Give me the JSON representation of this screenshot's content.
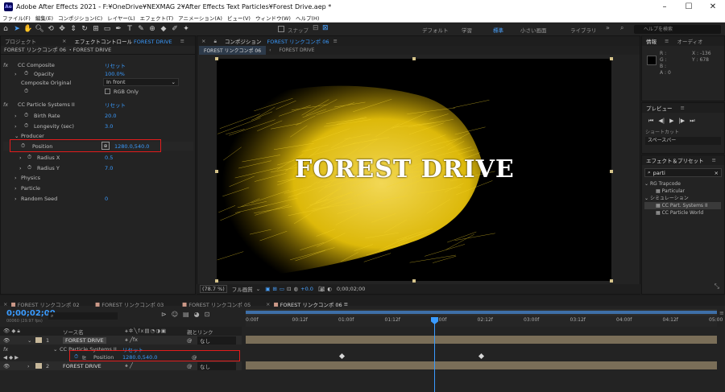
{
  "window": {
    "title": "Adobe After Effects 2021 - F:¥OneDrive¥NEXMAG 2¥After Effects Text Particles¥Forest Drive.aep *",
    "app_logo": "Ae"
  },
  "menu": [
    "ファイル(F)",
    "編集(E)",
    "コンポジション(C)",
    "レイヤー(L)",
    "エフェクト(T)",
    "アニメーション(A)",
    "ビュー(V)",
    "ウィンドウ(W)",
    "ヘルプ(H)"
  ],
  "toolbar": {
    "snap_label": "スナップ",
    "workspaces": [
      "デフォルト",
      "学習",
      "標準",
      "小さい画面",
      "ライブラリ"
    ],
    "active_workspace": "標準",
    "help_search_placeholder": "ヘルプを検索"
  },
  "effects_panel": {
    "tab_project": "プロジェクト",
    "tab_effects": "エフェクトコントロール",
    "tab_effects_target": "FOREST DRIVE",
    "header": "FOREST リンクコンポ 06 ・FOREST DRIVE",
    "rows": [
      {
        "label": "CC Composite",
        "value": "リセット",
        "kind": "effect"
      },
      {
        "label": "Opacity",
        "value": "100.0%",
        "kind": "prop"
      },
      {
        "label": "Composite Original",
        "value": "In front",
        "kind": "dropdown"
      },
      {
        "label": "",
        "value": "RGB Only",
        "kind": "check"
      },
      {
        "label": "CC Particle Systems II",
        "value": "リセット",
        "kind": "effect"
      },
      {
        "label": "Birth Rate",
        "value": "20.0",
        "kind": "prop"
      },
      {
        "label": "Longevity (sec)",
        "value": "3.0",
        "kind": "prop"
      },
      {
        "label": "Producer",
        "value": "",
        "kind": "group"
      },
      {
        "label": "Position",
        "value": "1280.0,540.0",
        "kind": "position"
      },
      {
        "label": "Radius X",
        "value": "0.5",
        "kind": "prop"
      },
      {
        "label": "Radius Y",
        "value": "7.0",
        "kind": "prop"
      },
      {
        "label": "Physics",
        "value": "",
        "kind": "group"
      },
      {
        "label": "Particle",
        "value": "",
        "kind": "group"
      },
      {
        "label": "Random Seed",
        "value": "0",
        "kind": "prop"
      }
    ]
  },
  "comp_panel": {
    "tab_prefix": "コンポジション",
    "tab_name": "FOREST リンクコンポ 06",
    "sub_tabs": [
      "FOREST リンクコンポ 06",
      "FOREST DRIVE"
    ],
    "text": "FOREST DRIVE",
    "zoom": "(78.7 %)",
    "quality": "フル画質",
    "exposure": "+0.0",
    "time": "0;00;02;00"
  },
  "info_panel": {
    "tab_info": "情報",
    "tab_audio": "オーディオ",
    "r": "R :",
    "g": "G :",
    "b": "B :",
    "a": "A : 0",
    "x": "X : -136",
    "y": "Y : 678"
  },
  "preview_panel": {
    "title": "プレビュー",
    "shortcut_label": "ショートカット",
    "shortcut_value": "スペースバー"
  },
  "effects_presets": {
    "title": "エフェクト＆プリセット",
    "search": "parti",
    "groups": [
      {
        "name": "RG Trapcode",
        "items": [
          "Particular"
        ]
      },
      {
        "name": "シミュレーション",
        "items": [
          "CC Part. Systems II",
          "CC Particle World"
        ]
      }
    ]
  },
  "timeline": {
    "tabs": [
      "FOREST リンクコンポ 02",
      "FOREST リンクコンポ 03",
      "FOREST リンクコンポ 05",
      "FOREST リンクコンポ 06"
    ],
    "active_tab": "FOREST リンクコンポ 06",
    "time": "0;00;02;00",
    "frames": "00060 (29.97 fps)",
    "col_source": "ソース名",
    "col_parent": "親とリンク",
    "layers": [
      {
        "num": "1",
        "name": "FOREST DRIVE",
        "parent": "なし"
      },
      {
        "num": "2",
        "name": "FOREST DRIVE",
        "parent": "なし"
      }
    ],
    "effect_row": "CC Particle Systems II",
    "effect_reset": "リセット",
    "position_label": "Position",
    "position_value": "1280.0,540.0",
    "ruler": [
      "0:00f",
      "00:12f",
      "01:00f",
      "01:12f",
      "02:00f",
      "02:12f",
      "03:00f",
      "03:12f",
      "04:00f",
      "04:12f",
      "05:00"
    ]
  }
}
